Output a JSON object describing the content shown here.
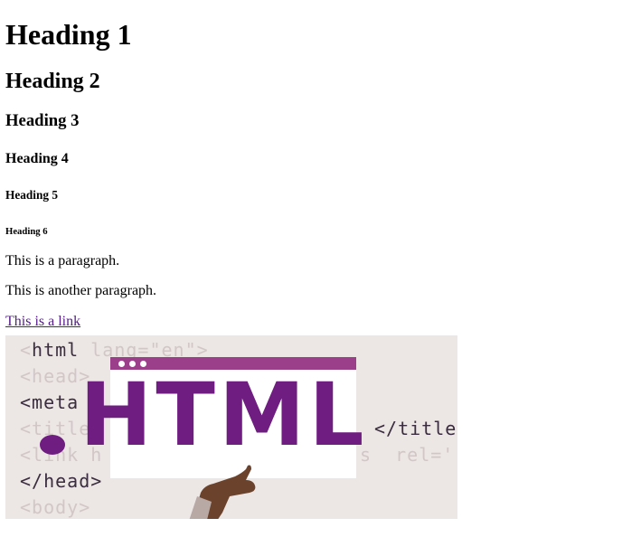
{
  "headings": {
    "h1": "Heading 1",
    "h2": "Heading 2",
    "h3": "Heading 3",
    "h4": "Heading 4",
    "h5": "Heading 5",
    "h6": "Heading 6"
  },
  "paragraphs": [
    "This is a paragraph.",
    "This is another paragraph."
  ],
  "link": {
    "text": "This is a link"
  },
  "image": {
    "big_text": "HTML",
    "code_lines": [
      {
        "text": "<html lang=\"en\">",
        "tone": "mixed"
      },
      {
        "text": "<head>",
        "tone": "dim"
      },
      {
        "text": "<meta",
        "tone": "dark"
      },
      {
        "text": "<title",
        "tone": "dim"
      },
      {
        "text": "<link h",
        "tone": "dim"
      },
      {
        "text": "</head>",
        "tone": "dark"
      },
      {
        "text": "<body>",
        "tone": "dim"
      }
    ],
    "right_code": [
      {
        "text": "</title",
        "tone": "dark"
      },
      {
        "text": "s  rel='",
        "tone": "dim"
      }
    ],
    "colors": {
      "background": "#ece6e5",
      "accent_purple": "#6f1d81",
      "window_bar": "#9c3f8b",
      "skin": "#6b432c"
    }
  }
}
